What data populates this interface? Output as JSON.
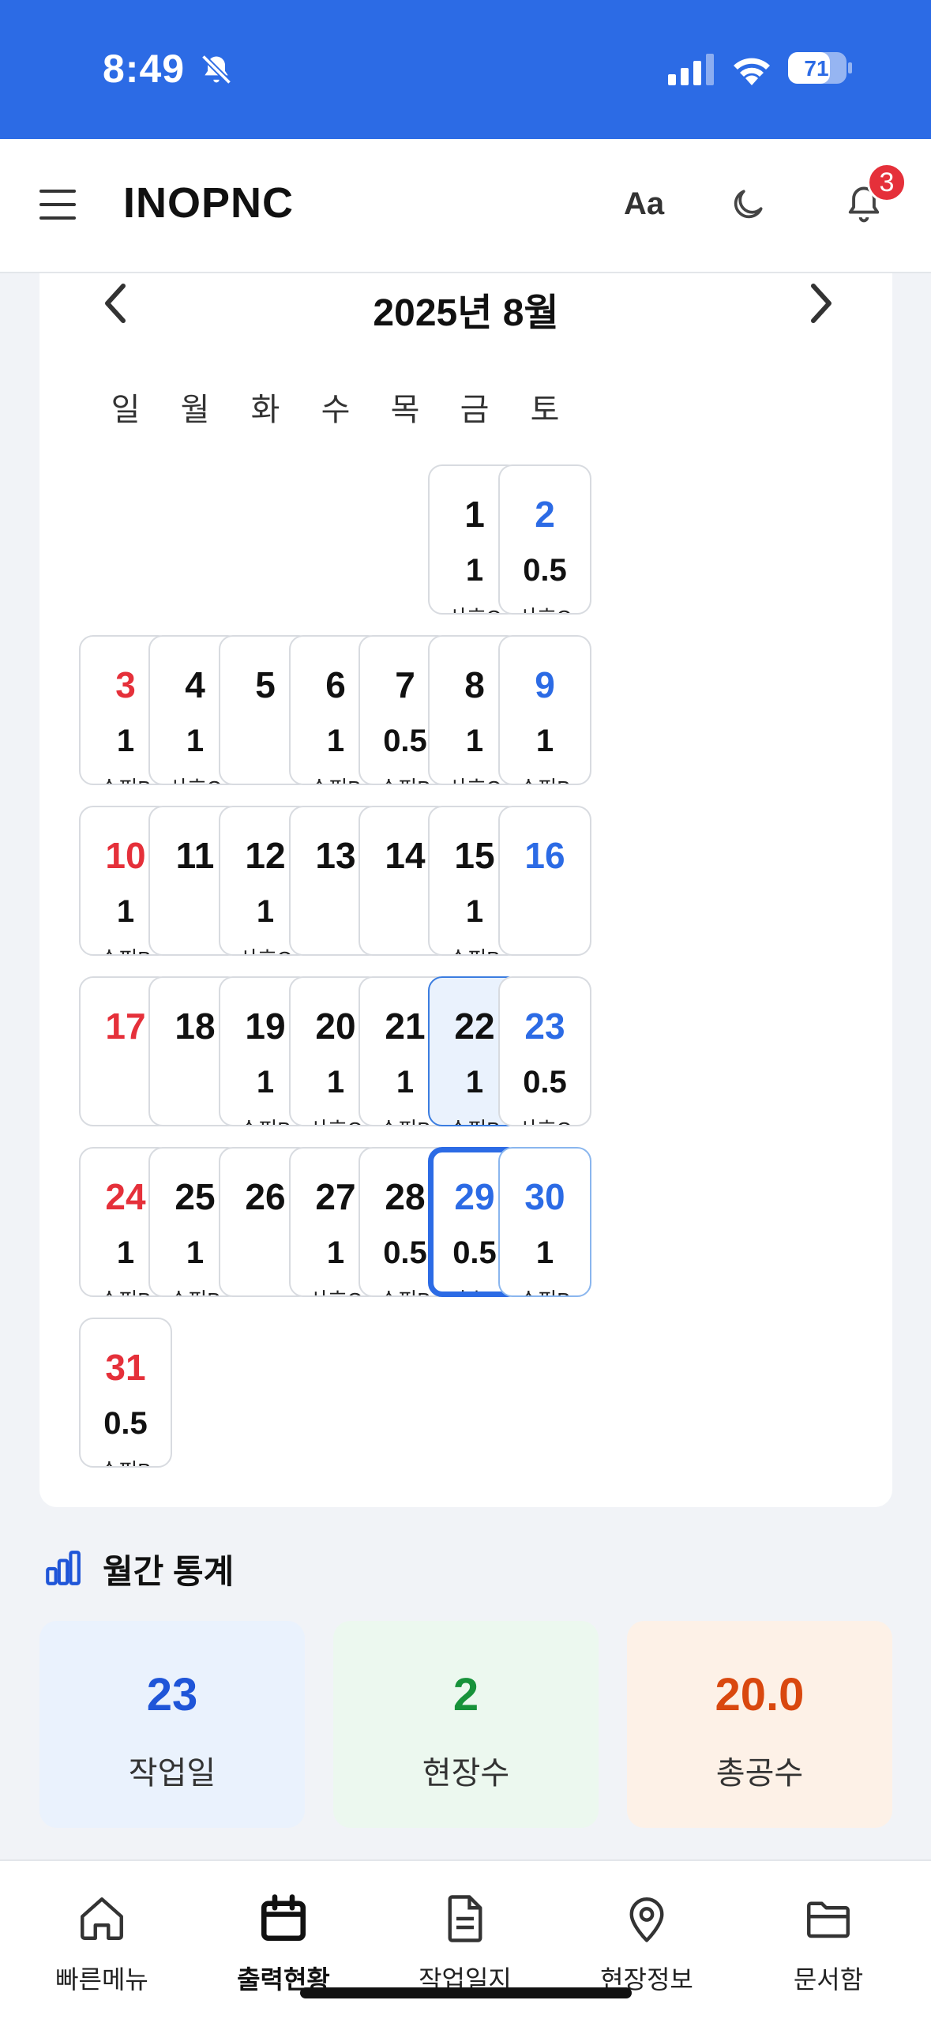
{
  "status_bar": {
    "time": "8:49",
    "battery": "71"
  },
  "header": {
    "brand": "INOPNC",
    "font_label": "Aa",
    "notification_count": "3"
  },
  "calendar": {
    "title": "2025년 8월",
    "weekdays": [
      "일",
      "월",
      "화",
      "수",
      "목",
      "금",
      "토"
    ],
    "days": [
      {
        "day": "1",
        "value": "1",
        "site": "사호C"
      },
      {
        "day": "2",
        "value": "0.5",
        "site": "사호C"
      },
      {
        "day": "3",
        "value": "1",
        "site": "수피B"
      },
      {
        "day": "4",
        "value": "1",
        "site": "사호C"
      },
      {
        "day": "5",
        "value": "",
        "site": ""
      },
      {
        "day": "6",
        "value": "1",
        "site": "수피B"
      },
      {
        "day": "7",
        "value": "0.5",
        "site": "수피B"
      },
      {
        "day": "8",
        "value": "1",
        "site": "사호C"
      },
      {
        "day": "9",
        "value": "1",
        "site": "수피B"
      },
      {
        "day": "10",
        "value": "1",
        "site": "수피B"
      },
      {
        "day": "11",
        "value": "",
        "site": ""
      },
      {
        "day": "12",
        "value": "1",
        "site": "사호C"
      },
      {
        "day": "13",
        "value": "",
        "site": ""
      },
      {
        "day": "14",
        "value": "",
        "site": ""
      },
      {
        "day": "15",
        "value": "1",
        "site": "수피B"
      },
      {
        "day": "16",
        "value": "",
        "site": ""
      },
      {
        "day": "17",
        "value": "",
        "site": ""
      },
      {
        "day": "18",
        "value": "",
        "site": ""
      },
      {
        "day": "19",
        "value": "1",
        "site": "수피B"
      },
      {
        "day": "20",
        "value": "1",
        "site": "사호C"
      },
      {
        "day": "21",
        "value": "1",
        "site": "수피B"
      },
      {
        "day": "22",
        "value": "1",
        "site": "수피B"
      },
      {
        "day": "23",
        "value": "0.5",
        "site": "사호C"
      },
      {
        "day": "24",
        "value": "1",
        "site": "수피B"
      },
      {
        "day": "25",
        "value": "1",
        "site": "수피B"
      },
      {
        "day": "26",
        "value": "",
        "site": ""
      },
      {
        "day": "27",
        "value": "1",
        "site": "사호C"
      },
      {
        "day": "28",
        "value": "0.5",
        "site": "수피B"
      },
      {
        "day": "29",
        "value": "0.5",
        "site": "사호C"
      },
      {
        "day": "30",
        "value": "1",
        "site": "수피B"
      },
      {
        "day": "31",
        "value": "0.5",
        "site": "수피B"
      }
    ],
    "first_weekday": 5,
    "selected_day": "22",
    "today_day": "29",
    "highlight_day": "30"
  },
  "stats": {
    "title": "월간 통계",
    "items": [
      {
        "value": "23",
        "label": "작업일",
        "color": "#1f55d8",
        "bg": "#eaf2fd"
      },
      {
        "value": "2",
        "label": "현장수",
        "color": "#17923a",
        "bg": "#ecf8ef"
      },
      {
        "value": "20.0",
        "label": "총공수",
        "color": "#d9480f",
        "bg": "#fdf1e7"
      }
    ]
  },
  "bottom_nav": [
    {
      "label": "빠른메뉴",
      "icon": "home-icon",
      "active": false
    },
    {
      "label": "출력현황",
      "icon": "calendar-icon",
      "active": true
    },
    {
      "label": "작업일지",
      "icon": "document-icon",
      "active": false
    },
    {
      "label": "현장정보",
      "icon": "map-pin-icon",
      "active": false
    },
    {
      "label": "문서함",
      "icon": "folder-icon",
      "active": false
    }
  ]
}
